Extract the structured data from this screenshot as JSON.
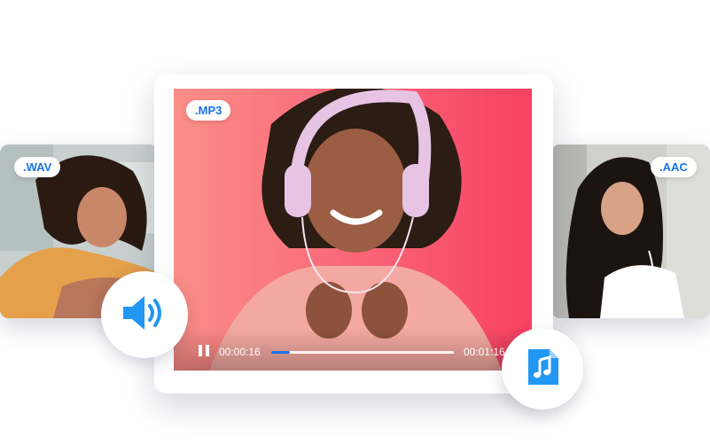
{
  "formats": {
    "left": ".WAV",
    "center": ".MP3",
    "right": ".AAC"
  },
  "player": {
    "current_time": "00:00:16",
    "total_time": "00:01:16",
    "progress": 0.1,
    "state": "playing"
  },
  "icons": {
    "pause": "pause-icon",
    "volume": "volume-icon",
    "music_file": "music-file-icon"
  },
  "colors": {
    "accent": "#1a73e8",
    "file_icon": "#2196f3",
    "video_gradient_start": "#fb8f88",
    "video_gradient_end": "#f84163"
  }
}
